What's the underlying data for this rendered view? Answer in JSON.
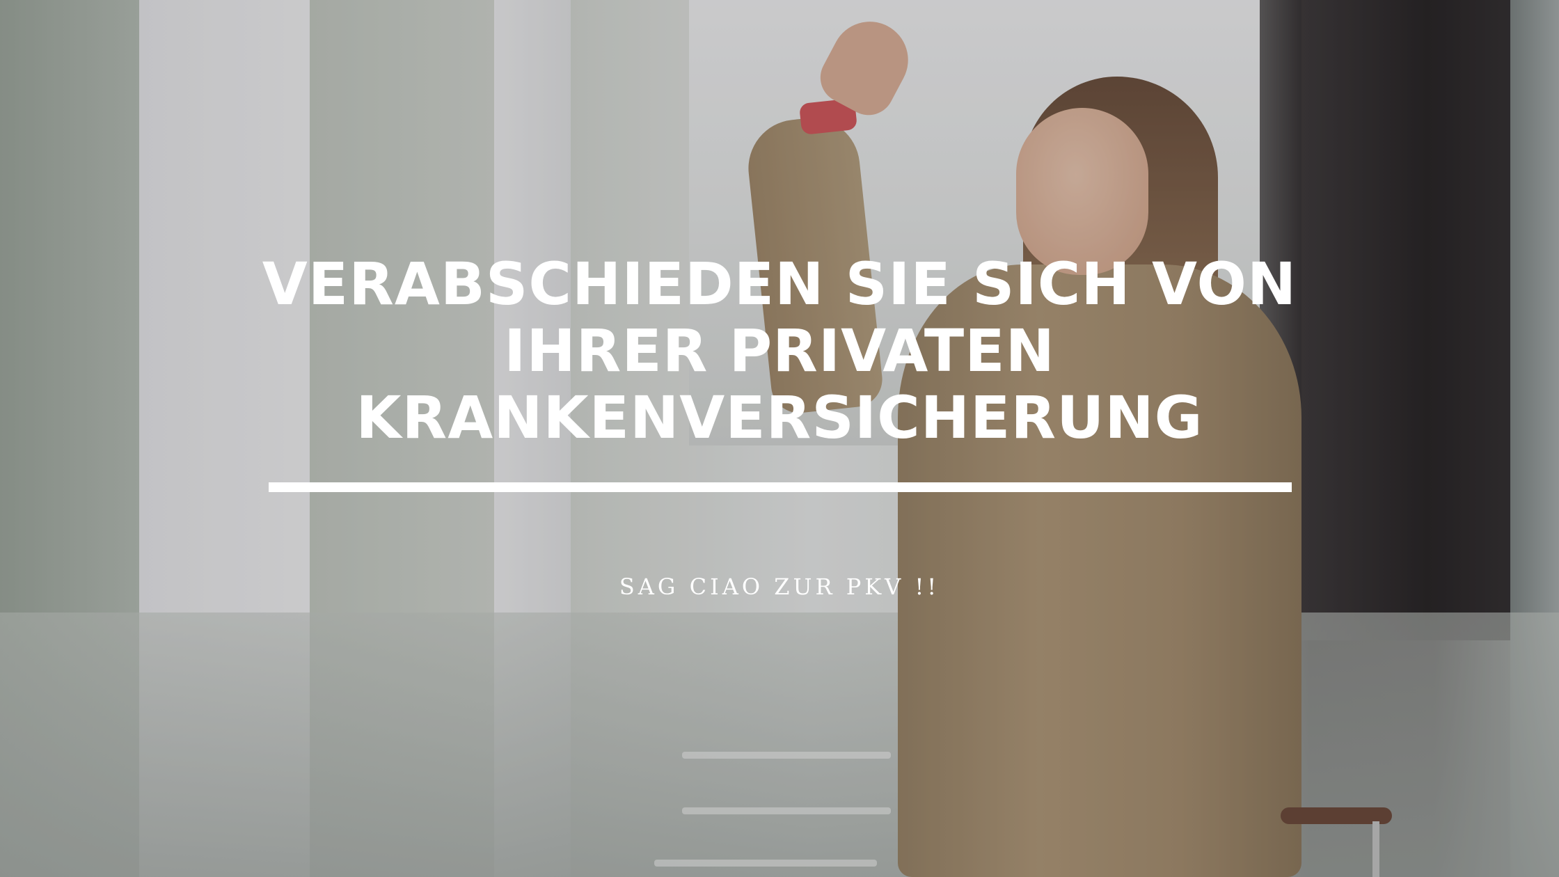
{
  "headline": {
    "lines": [
      "VERABSCHIEDEN SIE SICH VON",
      "IHRER PRIVATEN",
      "KRANKENVERSICHERUNG"
    ]
  },
  "subline": "SAG CIAO ZUR PKV !!",
  "colors": {
    "text": "#ffffff",
    "divider": "#ffffff",
    "coat": "#b39a79",
    "sleeve_cuff": "#d8555a"
  },
  "background_photo": "woman-waving-in-airport-corridor"
}
